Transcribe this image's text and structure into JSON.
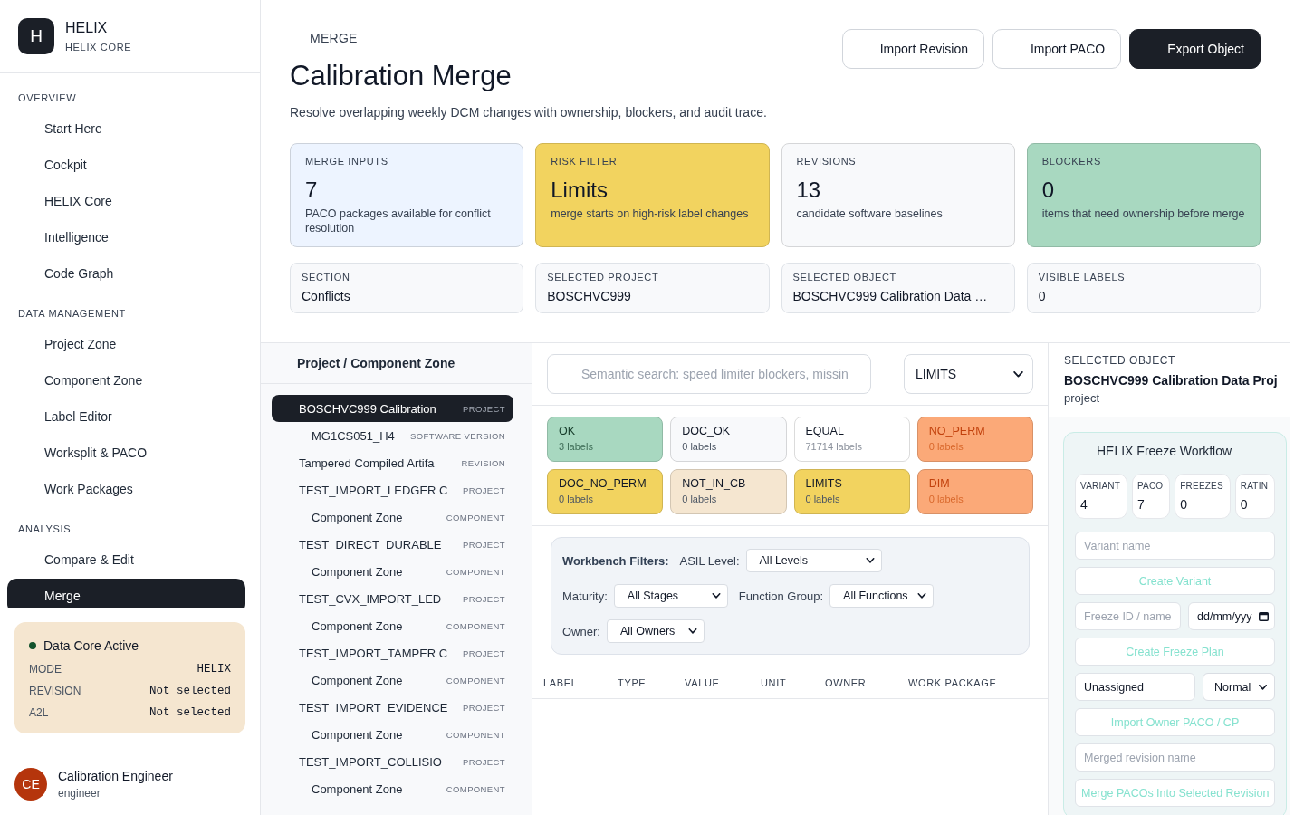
{
  "sidebar": {
    "brand": {
      "logo": "H",
      "title": "HELIX",
      "subtitle": "HELIX CORE"
    },
    "sections": [
      {
        "title": "OVERVIEW",
        "items": [
          {
            "label": "Start Here",
            "selected": false
          },
          {
            "label": "Cockpit",
            "selected": false
          },
          {
            "label": "HELIX Core",
            "selected": false
          },
          {
            "label": "Intelligence",
            "selected": false
          },
          {
            "label": "Code Graph",
            "selected": false
          }
        ]
      },
      {
        "title": "DATA MANAGEMENT",
        "items": [
          {
            "label": "Project Zone",
            "selected": false
          },
          {
            "label": "Component Zone",
            "selected": false
          },
          {
            "label": "Label Editor",
            "selected": false
          },
          {
            "label": "Worksplit & PACO",
            "selected": false
          },
          {
            "label": "Work Packages",
            "selected": false
          }
        ]
      },
      {
        "title": "ANALYSIS",
        "items": [
          {
            "label": "Compare & Edit",
            "selected": false
          },
          {
            "label": "Merge",
            "selected": true
          }
        ]
      }
    ],
    "status": {
      "title": "Data Core Active",
      "active": true,
      "rows": [
        {
          "label": "MODE",
          "value": "HELIX"
        },
        {
          "label": "REVISION",
          "value": "Not selected"
        },
        {
          "label": "A2L",
          "value": "Not selected"
        }
      ]
    },
    "user": {
      "initials": "CE",
      "name": "Calibration Engineer",
      "role": "engineer"
    }
  },
  "header": {
    "eyebrow": "MERGE",
    "title": "Calibration Merge",
    "description": "Resolve overlapping weekly DCM changes with ownership, blockers, and audit trace.",
    "buttons": [
      {
        "label": "Import Revision",
        "kind": "secondary"
      },
      {
        "label": "Import PACO",
        "kind": "secondary"
      },
      {
        "label": "Export Object",
        "kind": "primary"
      }
    ]
  },
  "stat_cards": [
    {
      "label": "MERGE INPUTS",
      "value": "7",
      "note": "PACO packages available for conflict resolution",
      "color": "#edf4ff"
    },
    {
      "label": "RISK FILTER",
      "value": "Limits",
      "note": "merge starts on high-risk label changes",
      "color": "#f2d35f"
    },
    {
      "label": "REVISIONS",
      "value": "13",
      "note": "candidate software baselines",
      "color": "#f8f9fb"
    },
    {
      "label": "BLOCKERS",
      "value": "0",
      "note": "items that need ownership before merge",
      "color": "#a8d8c0"
    }
  ],
  "info_cards": [
    {
      "label": "SECTION",
      "value": "Conflicts"
    },
    {
      "label": "SELECTED PROJECT",
      "value": "BOSCHVC999"
    },
    {
      "label": "SELECTED OBJECT",
      "value": "BOSCHVC999 Calibration Data …"
    },
    {
      "label": "VISIBLE LABELS",
      "value": "0"
    }
  ],
  "tree": {
    "title": "Project / Component Zone",
    "items": [
      {
        "name": "BOSCHVC999 Calibration",
        "type": "PROJECT",
        "selected": true,
        "children": [
          {
            "name": "MG1CS051_H4",
            "type": "SOFTWARE VERSION",
            "selected": false
          }
        ]
      },
      {
        "name": "Tampered Compiled Artifa",
        "type": "REVISION",
        "selected": false
      },
      {
        "name": "TEST_IMPORT_LEDGER C",
        "type": "PROJECT",
        "selected": false,
        "children": [
          {
            "name": "Component Zone",
            "type": "COMPONENT",
            "selected": false
          }
        ]
      },
      {
        "name": "TEST_DIRECT_DURABLE_",
        "type": "PROJECT",
        "selected": false,
        "children": [
          {
            "name": "Component Zone",
            "type": "COMPONENT",
            "selected": false
          }
        ]
      },
      {
        "name": "TEST_CVX_IMPORT_LED",
        "type": "PROJECT",
        "selected": false,
        "children": [
          {
            "name": "Component Zone",
            "type": "COMPONENT",
            "selected": false
          }
        ]
      },
      {
        "name": "TEST_IMPORT_TAMPER C",
        "type": "PROJECT",
        "selected": false,
        "children": [
          {
            "name": "Component Zone",
            "type": "COMPONENT",
            "selected": false
          }
        ]
      },
      {
        "name": "TEST_IMPORT_EVIDENCE",
        "type": "PROJECT",
        "selected": false,
        "children": [
          {
            "name": "Component Zone",
            "type": "COMPONENT",
            "selected": false
          }
        ]
      },
      {
        "name": "TEST_IMPORT_COLLISIO",
        "type": "PROJECT",
        "selected": false,
        "children": [
          {
            "name": "Component Zone",
            "type": "COMPONENT",
            "selected": false
          }
        ]
      }
    ]
  },
  "search": {
    "placeholder": "Semantic search: speed limiter blockers, missin"
  },
  "risk_select": {
    "value": "LIMITS"
  },
  "status_tiles": [
    {
      "label": "OK",
      "count": "3 labels",
      "color": "#a8d8c0"
    },
    {
      "label": "DOC_OK",
      "count": "0 labels",
      "color": "#f8f9fb"
    },
    {
      "label": "EQUAL",
      "count": "71714 labels",
      "color": "#ffffff"
    },
    {
      "label": "NO_PERM",
      "count": "0 labels",
      "color": "#fba978"
    },
    {
      "label": "DOC_NO_PERM",
      "count": "0 labels",
      "color": "#f2d35f"
    },
    {
      "label": "NOT_IN_CB",
      "count": "0 labels",
      "color": "#f5e6d0"
    },
    {
      "label": "LIMITS",
      "count": "0 labels",
      "color": "#f2d35f"
    },
    {
      "label": "DIM",
      "count": "0 labels",
      "color": "#fba978"
    }
  ],
  "filters": {
    "title": "Workbench Filters:",
    "fields": [
      {
        "label": "ASIL Level:",
        "value": "All Levels"
      },
      {
        "label": "Maturity:",
        "value": "All Stages"
      },
      {
        "label": "Function Group:",
        "value": "All Functions"
      },
      {
        "label": "Owner:",
        "value": "All Owners"
      }
    ]
  },
  "table": {
    "columns": [
      "LABEL",
      "TYPE",
      "VALUE",
      "UNIT",
      "OWNER",
      "WORK PACKAGE"
    ]
  },
  "selected_object": {
    "label": "SELECTED OBJECT",
    "name": "BOSCHVC999 Calibration Data Proj",
    "type": "project"
  },
  "workflow": {
    "title": "HELIX Freeze Workflow",
    "stats": [
      {
        "label": "VARIANT",
        "value": "4"
      },
      {
        "label": "PACO",
        "value": "7"
      },
      {
        "label": "FREEZES",
        "value": "0"
      },
      {
        "label": "RATIN",
        "value": "0"
      }
    ],
    "controls": [
      {
        "kind": "input",
        "placeholder": "Variant name"
      },
      {
        "kind": "button",
        "label": "Create Variant",
        "disabled": true
      },
      {
        "kind": "pair",
        "fields": [
          {
            "kind": "input",
            "placeholder": "Freeze ID / name"
          },
          {
            "kind": "date",
            "placeholder": "dd/mm/yyy"
          }
        ]
      },
      {
        "kind": "button",
        "label": "Create Freeze Plan",
        "disabled": true
      },
      {
        "kind": "pair",
        "fields": [
          {
            "kind": "input",
            "value": "Unassigned"
          },
          {
            "kind": "select",
            "value": "Normal"
          }
        ]
      },
      {
        "kind": "button",
        "label": "Import Owner PACO / CP",
        "disabled": true
      },
      {
        "kind": "input",
        "placeholder": "Merged revision name"
      },
      {
        "kind": "button",
        "label": "Merge PACOs Into Selected Revision",
        "disabled": true
      }
    ]
  }
}
